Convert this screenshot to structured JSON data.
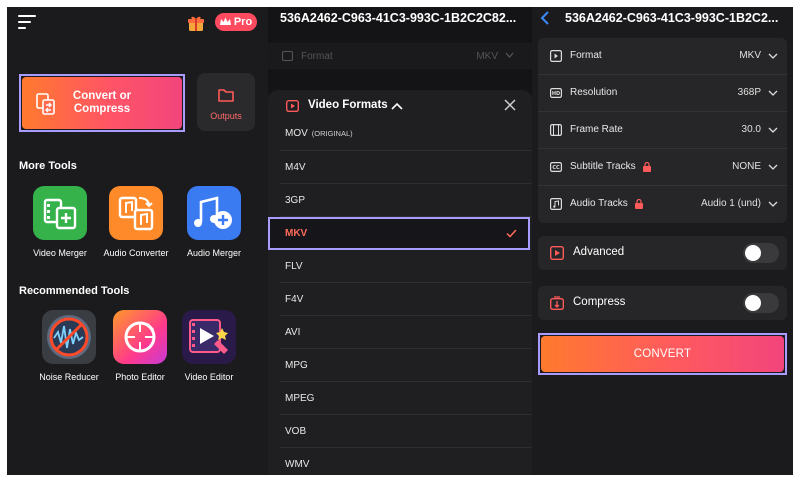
{
  "left": {
    "pro_label": "Pro",
    "convert_label": "Convert or Compress",
    "outputs_label": "Outputs",
    "more_tools_title": "More Tools",
    "more_tools": [
      {
        "name": "Video Merger",
        "color": "#35b24a"
      },
      {
        "name": "Audio Converter",
        "color": "#ff8a2a"
      },
      {
        "name": "Audio Merger",
        "color": "#3b7bf2"
      }
    ],
    "recommended_title": "Recommended Tools",
    "recommended_tools": [
      {
        "name": "Noise Reducer"
      },
      {
        "name": "Photo Editor"
      },
      {
        "name": "Video Editor"
      }
    ]
  },
  "middle": {
    "file_title": "536A2462-C963-41C3-993C-1B2C2C82...",
    "format_row": {
      "label": "Format",
      "value": "MKV"
    },
    "sheet_title": "Video Formats",
    "options": [
      {
        "label": "MOV",
        "sub": "(ORIGINAL)",
        "selected": false
      },
      {
        "label": "M4V",
        "selected": false
      },
      {
        "label": "3GP",
        "selected": false
      },
      {
        "label": "MKV",
        "selected": true
      },
      {
        "label": "FLV",
        "selected": false
      },
      {
        "label": "F4V",
        "selected": false
      },
      {
        "label": "AVI",
        "selected": false
      },
      {
        "label": "MPG",
        "selected": false
      },
      {
        "label": "MPEG",
        "selected": false
      },
      {
        "label": "VOB",
        "selected": false
      },
      {
        "label": "WMV",
        "selected": false
      }
    ]
  },
  "right": {
    "file_title": "536A2462-C963-41C3-993C-1B2C2...",
    "settings": [
      {
        "label": "Format",
        "value": "MKV",
        "icon": "play-square-icon"
      },
      {
        "label": "Resolution",
        "value": "368P",
        "icon": "hd-icon"
      },
      {
        "label": "Frame Rate",
        "value": "30.0",
        "icon": "film-icon"
      },
      {
        "label": "Subtitle Tracks",
        "value": "NONE",
        "icon": "cc-icon",
        "locked": true
      },
      {
        "label": "Audio Tracks",
        "value": "Audio 1 (und)",
        "icon": "music-note-icon",
        "locked": true
      }
    ],
    "advanced_label": "Advanced",
    "compress_label": "Compress",
    "convert_button": "CONVERT"
  },
  "colors": {
    "accent": "#ff5466",
    "highlight_border": "#a89cff",
    "selected_text": "#ff6b5a",
    "panel_bg": "#1b1b1d"
  }
}
